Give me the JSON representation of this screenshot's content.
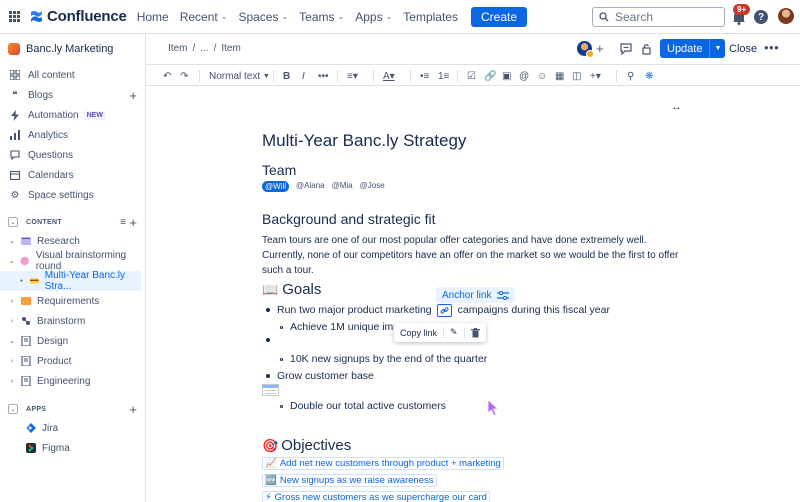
{
  "topnav": {
    "app_name": "Confluence",
    "items": [
      {
        "label": "Home",
        "has_menu": false
      },
      {
        "label": "Recent",
        "has_menu": true
      },
      {
        "label": "Spaces",
        "has_menu": true
      },
      {
        "label": "Teams",
        "has_menu": true
      },
      {
        "label": "Apps",
        "has_menu": true
      },
      {
        "label": "Templates",
        "has_menu": false
      }
    ],
    "create_label": "Create",
    "search_placeholder": "Search",
    "notification_count": "9+",
    "help_label": "?"
  },
  "sidebar": {
    "space_name": "Banc.ly Marketing",
    "nav": [
      {
        "label": "All content",
        "icon": "list-icon"
      },
      {
        "label": "Blogs",
        "icon": "quote-icon"
      },
      {
        "label": "Automation",
        "icon": "lightning-icon",
        "lozenge": "NEW"
      },
      {
        "label": "Analytics",
        "icon": "chart-icon"
      },
      {
        "label": "Questions",
        "icon": "chat-icon"
      },
      {
        "label": "Calendars",
        "icon": "calendar-icon"
      },
      {
        "label": "Space settings",
        "icon": "gear-icon"
      }
    ],
    "content_section": "CONTENT",
    "tree": [
      {
        "label": "Research",
        "indent": 0
      },
      {
        "label": "Visual brainstorming round",
        "indent": 0
      },
      {
        "label": "Multi-Year Banc.ly Stra...",
        "indent": 1
      },
      {
        "label": "Requirements",
        "indent": 0
      },
      {
        "label": "Brainstorm",
        "indent": 0
      },
      {
        "label": "Design",
        "indent": 0
      },
      {
        "label": "Product",
        "indent": 0
      },
      {
        "label": "Engineering",
        "indent": 0
      }
    ],
    "apps_section": "APPS",
    "apps": [
      {
        "label": "Jira"
      },
      {
        "label": "Figma"
      }
    ]
  },
  "page_toolbar": {
    "breadcrumb": [
      "Item",
      "/",
      "...",
      "/",
      "Item"
    ],
    "update_label": "Update",
    "close_label": "Close"
  },
  "editor_toolbar": {
    "text_style": "Normal text"
  },
  "document": {
    "title": "Multi-Year Banc.ly Strategy",
    "team_heading": "Team",
    "mentions": [
      "@Will",
      "@Alana",
      "@Mia",
      "@Jose"
    ],
    "background_heading": "Background and strategic fit",
    "background_text": "Team tours are one of our most popular offer categories and have done extremely well. Currently, none of our competitors have an offer on the market so we would be the first to offer such a tour.",
    "goals_heading": "Goals",
    "goals": {
      "item1_before": "Run two major product marketing",
      "item1_after": "campaigns during this fiscal year",
      "sub1": "Achieve 1M unique imp",
      "sub2": "10K new signups by the end of the quarter",
      "item3": "Grow customer base",
      "sub3": "Double our total active customers"
    },
    "anchor_popup": "Anchor link",
    "copy_link": "Copy link",
    "objectives_heading": "Objectives",
    "objectives": [
      {
        "emoji": "📈",
        "text": "Add net new customers through product + marketing"
      },
      {
        "emoji": "🆕",
        "text": "New signups as we raise awareness"
      },
      {
        "emoji": "⚡",
        "text": "Gross new customers as we supercharge our card"
      }
    ]
  },
  "colors": {
    "brand": "#0c66e4",
    "text": "#172b4d",
    "subtle": "#44546f",
    "selected_bg": "#e9f2ff"
  }
}
